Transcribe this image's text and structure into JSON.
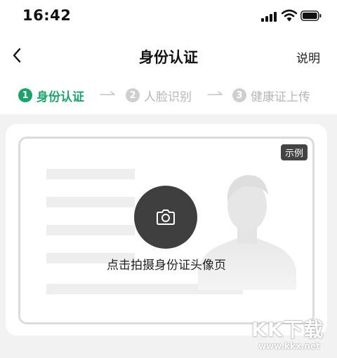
{
  "status_bar": {
    "time": "16:42",
    "icons": [
      "signal-icon",
      "wifi-icon",
      "battery-icon"
    ]
  },
  "nav": {
    "back_icon": "chevron-left-icon",
    "title": "身份认证",
    "help_label": "说明"
  },
  "steps": [
    {
      "number": "1",
      "label": "身份认证",
      "state": "active"
    },
    {
      "number": "2",
      "label": "人脸识别",
      "state": "inactive"
    },
    {
      "number": "3",
      "label": "健康证上传",
      "state": "inactive"
    }
  ],
  "id_capture": {
    "example_badge": "示例",
    "camera_icon": "camera-icon",
    "hint": "点击拍摄身份证头像页"
  },
  "watermark": {
    "logo": "KK下载",
    "url": "www.kkx.net"
  },
  "colors": {
    "accent": "#1aa36a",
    "inactive": "#cfcfcf",
    "camera_button": "#3f3f3f",
    "background": "#f2f2f2"
  }
}
